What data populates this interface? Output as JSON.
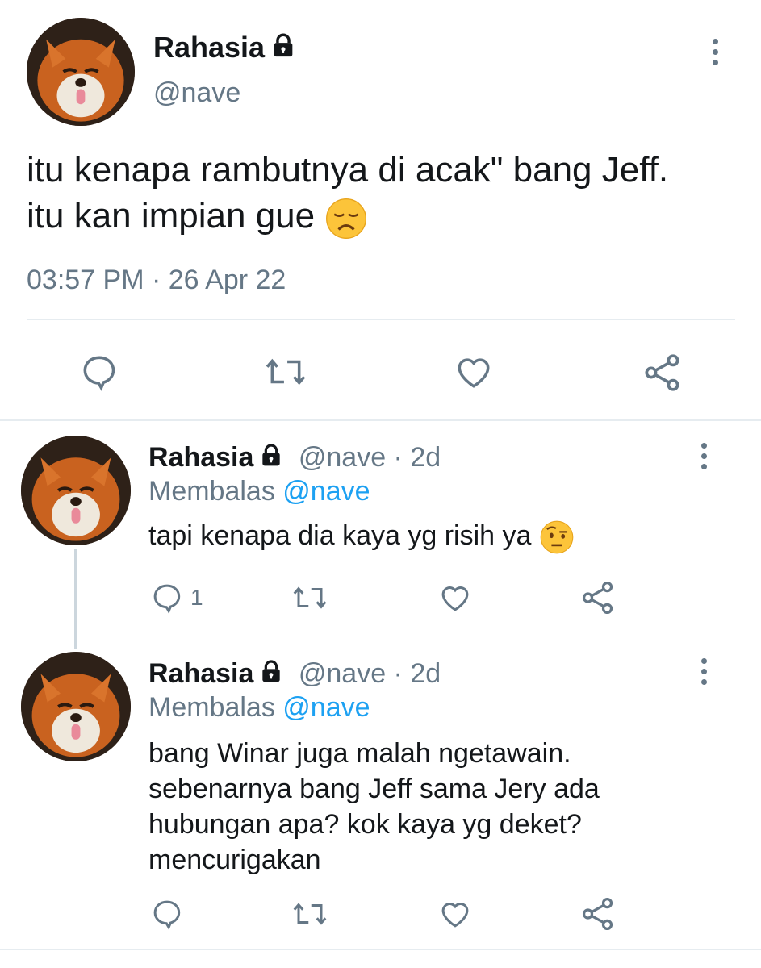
{
  "main_tweet": {
    "name": "Rahasia",
    "handle": "@nave",
    "text_line1": "itu kenapa rambutnya di acak\" bang Jeff.",
    "text_line2": "itu kan impian gue",
    "time": "03:57 PM",
    "date": "26 Apr 22",
    "emoji": "disappointed-face"
  },
  "replies": [
    {
      "name": "Rahasia",
      "handle": "@nave",
      "age": "2d",
      "replying_prefix": "Membalas",
      "replying_to": "@nave",
      "text": "tapi kenapa dia kaya yg risih ya",
      "emoji": "face-with-raised-eyebrow",
      "reply_count": "1"
    },
    {
      "name": "Rahasia",
      "handle": "@nave",
      "age": "2d",
      "replying_prefix": "Membalas",
      "replying_to": "@nave",
      "text_lines": [
        "bang Winar juga malah ngetawain.",
        "sebenarnya bang Jeff sama Jery ada",
        "hubungan apa? kok kaya yg deket?",
        "mencurigakan"
      ]
    }
  ],
  "colors": {
    "text": "#14171a",
    "secondary": "#657786",
    "accent": "#1da1f2",
    "divider": "#e6ecf0"
  }
}
